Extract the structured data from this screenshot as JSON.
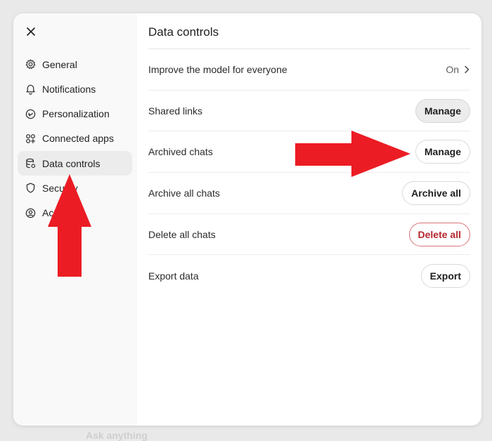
{
  "backdrop": {
    "text": "Ask anything"
  },
  "sidebar": {
    "close_icon": "close-icon",
    "items": [
      {
        "label": "General",
        "icon": "gear-icon",
        "active": false
      },
      {
        "label": "Notifications",
        "icon": "bell-icon",
        "active": false
      },
      {
        "label": "Personalization",
        "icon": "personalization-icon",
        "active": false
      },
      {
        "label": "Connected apps",
        "icon": "apps-icon",
        "active": false
      },
      {
        "label": "Data controls",
        "icon": "database-icon",
        "active": true
      },
      {
        "label": "Security",
        "icon": "shield-icon",
        "active": false
      },
      {
        "label": "Account",
        "icon": "user-icon",
        "active": false
      }
    ]
  },
  "main": {
    "title": "Data controls",
    "rows": [
      {
        "label": "Improve the model for everyone",
        "value": "On",
        "control": "chevron-right-icon"
      },
      {
        "label": "Shared links",
        "button": "Manage"
      },
      {
        "label": "Archived chats",
        "button": "Manage"
      },
      {
        "label": "Archive all chats",
        "button": "Archive all"
      },
      {
        "label": "Delete all chats",
        "button": "Delete all"
      },
      {
        "label": "Export data",
        "button": "Export"
      }
    ]
  },
  "annotations": {
    "arrow_color": "#ec1c24",
    "arrows": [
      "arrow-pointing-up-to-data-controls",
      "arrow-pointing-right-to-archived-manage"
    ]
  }
}
